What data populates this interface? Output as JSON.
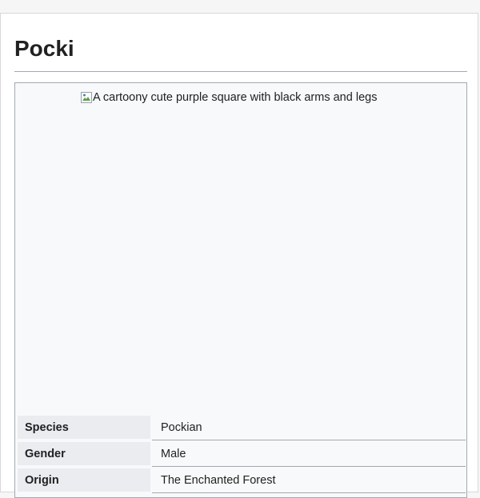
{
  "page": {
    "title": "Pocki"
  },
  "infobox": {
    "image_alt": "A cartoony cute purple square with black arms and legs",
    "image_icon": "broken-image-icon",
    "rows": [
      {
        "label": "Species",
        "value": "Pockian"
      },
      {
        "label": "Gender",
        "value": "Male"
      },
      {
        "label": "Origin",
        "value": "The Enchanted Forest"
      }
    ]
  },
  "colors": {
    "label_bg": "#eaecf0",
    "infobox_bg": "#f8f9fa",
    "border": "#a2a9b1",
    "text": "#202122"
  }
}
